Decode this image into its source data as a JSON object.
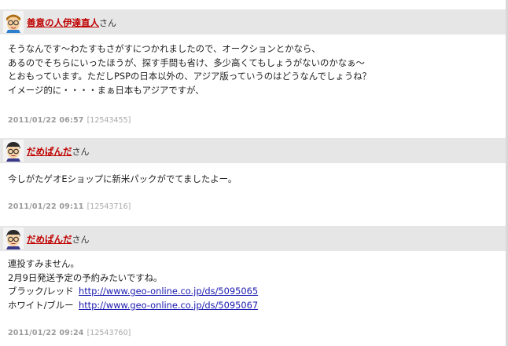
{
  "posts": [
    {
      "author": "善意の人伊達直人",
      "honorific": "さん",
      "avatar": "glasses-face-icon",
      "lines": [
        "そうなんです〜わたすもさがすにつかれましたので、オークションとかなら、",
        "あるのでそちらにいったほうが、探す手間も省け、多少高くてもしょうがないのかなぁ〜",
        "とおもっています。ただしPSPの日本以外の、アジア版っていうのはどうなんでしょうね？",
        "イメージ的に・・・・まぁ日本もアジアですが、"
      ],
      "date": "2011/01/22 06:57",
      "post_id": "[12543455]"
    },
    {
      "author": "だめぱんだ",
      "honorific": "さん",
      "avatar": "glasses-face-icon",
      "lines": [
        "今しがたゲオEショップに新米パックがでてましたよー。"
      ],
      "date": "2011/01/22 09:11",
      "post_id": "[12543716]"
    },
    {
      "author": "だめぱんだ",
      "honorific": "さん",
      "avatar": "glasses-face-icon",
      "lines": [
        "連投すみません。",
        "2月9日発送予定の予約みたいですね。"
      ],
      "links": [
        {
          "label": "ブラック/レッド",
          "url": "http://www.geo-online.co.jp/ds/5095065"
        },
        {
          "label": "ホワイト/ブルー",
          "url": "http://www.geo-online.co.jp/ds/5095067"
        }
      ],
      "date": "2011/01/22 09:24",
      "post_id": "[12543760]"
    }
  ]
}
